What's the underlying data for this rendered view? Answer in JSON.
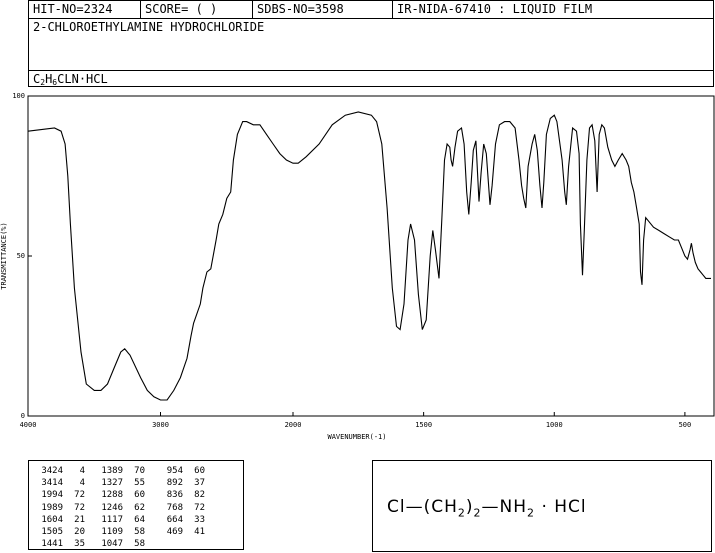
{
  "header": {
    "hit_no": "HIT-NO=2324",
    "score": "SCORE=  (   )",
    "sdbs_no": "SDBS-NO=3598",
    "ir_info": "IR-NIDA-67410 : LIQUID FILM",
    "compound_name": "2-CHLOROETHYLAMINE HYDROCHLORIDE",
    "formula_parts": [
      "C",
      "2",
      "H",
      "6",
      "CLN",
      "·HCL"
    ]
  },
  "structure": {
    "parts": [
      "Cl",
      "—",
      "(",
      "CH",
      "2",
      ")",
      "2",
      "—",
      "NH",
      "2",
      "·",
      "HCl"
    ]
  },
  "peak_table": {
    "rows": [
      [
        3424,
        4,
        1389,
        70,
        954,
        60
      ],
      [
        3414,
        4,
        1327,
        55,
        892,
        37
      ],
      [
        1994,
        72,
        1288,
        60,
        836,
        82
      ],
      [
        1989,
        72,
        1246,
        62,
        768,
        72
      ],
      [
        1604,
        21,
        1117,
        64,
        664,
        33
      ],
      [
        1505,
        20,
        1109,
        58,
        469,
        41
      ],
      [
        1441,
        35,
        1047,
        58,
        null,
        null
      ]
    ]
  },
  "chart_data": {
    "type": "line",
    "xlabel": "WAVENUMBER(-1)",
    "ylabel": "TRANSMITTANCE(%)",
    "xlim": [
      4000,
      400
    ],
    "ylim": [
      0,
      100
    ],
    "xticks": [
      4000,
      3000,
      2000,
      1500,
      1000,
      500
    ],
    "yticks": [
      0,
      50,
      100
    ],
    "grid": false,
    "series": [
      {
        "points": [
          [
            4000,
            89
          ],
          [
            3900,
            89.5
          ],
          [
            3800,
            90
          ],
          [
            3750,
            89
          ],
          [
            3720,
            85
          ],
          [
            3700,
            75
          ],
          [
            3680,
            60
          ],
          [
            3650,
            40
          ],
          [
            3600,
            20
          ],
          [
            3560,
            10
          ],
          [
            3500,
            8
          ],
          [
            3450,
            8
          ],
          [
            3400,
            10
          ],
          [
            3350,
            15
          ],
          [
            3300,
            20
          ],
          [
            3270,
            21
          ],
          [
            3230,
            19
          ],
          [
            3150,
            12
          ],
          [
            3100,
            8
          ],
          [
            3050,
            6
          ],
          [
            3000,
            5
          ],
          [
            2950,
            5
          ],
          [
            2900,
            8
          ],
          [
            2850,
            12
          ],
          [
            2800,
            18
          ],
          [
            2770,
            25
          ],
          [
            2750,
            29
          ],
          [
            2700,
            35
          ],
          [
            2680,
            40
          ],
          [
            2650,
            45
          ],
          [
            2620,
            46
          ],
          [
            2580,
            55
          ],
          [
            2560,
            60
          ],
          [
            2530,
            63
          ],
          [
            2500,
            68
          ],
          [
            2470,
            70
          ],
          [
            2450,
            80
          ],
          [
            2420,
            88
          ],
          [
            2380,
            92
          ],
          [
            2350,
            92
          ],
          [
            2300,
            91
          ],
          [
            2250,
            91
          ],
          [
            2200,
            88
          ],
          [
            2150,
            85
          ],
          [
            2100,
            82
          ],
          [
            2050,
            80
          ],
          [
            2000,
            79
          ],
          [
            1980,
            79
          ],
          [
            1950,
            81
          ],
          [
            1900,
            85
          ],
          [
            1850,
            91
          ],
          [
            1800,
            94
          ],
          [
            1750,
            95
          ],
          [
            1700,
            94
          ],
          [
            1680,
            92
          ],
          [
            1660,
            85
          ],
          [
            1640,
            65
          ],
          [
            1620,
            40
          ],
          [
            1604,
            28
          ],
          [
            1590,
            27
          ],
          [
            1575,
            35
          ],
          [
            1560,
            55
          ],
          [
            1550,
            60
          ],
          [
            1535,
            55
          ],
          [
            1520,
            38
          ],
          [
            1505,
            27
          ],
          [
            1490,
            30
          ],
          [
            1475,
            50
          ],
          [
            1465,
            58
          ],
          [
            1455,
            52
          ],
          [
            1441,
            43
          ],
          [
            1430,
            62
          ],
          [
            1420,
            80
          ],
          [
            1410,
            85
          ],
          [
            1400,
            84
          ],
          [
            1395,
            80
          ],
          [
            1389,
            78
          ],
          [
            1380,
            84
          ],
          [
            1370,
            89
          ],
          [
            1355,
            90
          ],
          [
            1345,
            85
          ],
          [
            1335,
            70
          ],
          [
            1327,
            63
          ],
          [
            1318,
            73
          ],
          [
            1310,
            83
          ],
          [
            1300,
            86
          ],
          [
            1288,
            67
          ],
          [
            1280,
            76
          ],
          [
            1270,
            85
          ],
          [
            1260,
            82
          ],
          [
            1246,
            66
          ],
          [
            1238,
            72
          ],
          [
            1225,
            85
          ],
          [
            1210,
            91
          ],
          [
            1190,
            92
          ],
          [
            1170,
            92
          ],
          [
            1150,
            90
          ],
          [
            1135,
            80
          ],
          [
            1125,
            72
          ],
          [
            1117,
            68
          ],
          [
            1109,
            65
          ],
          [
            1100,
            78
          ],
          [
            1085,
            85
          ],
          [
            1075,
            88
          ],
          [
            1065,
            83
          ],
          [
            1055,
            72
          ],
          [
            1047,
            65
          ],
          [
            1040,
            73
          ],
          [
            1030,
            88
          ],
          [
            1015,
            93
          ],
          [
            1000,
            94
          ],
          [
            990,
            92
          ],
          [
            980,
            86
          ],
          [
            970,
            80
          ],
          [
            960,
            70
          ],
          [
            954,
            66
          ],
          [
            945,
            78
          ],
          [
            930,
            90
          ],
          [
            915,
            89
          ],
          [
            905,
            82
          ],
          [
            900,
            60
          ],
          [
            892,
            44
          ],
          [
            885,
            58
          ],
          [
            875,
            80
          ],
          [
            865,
            90
          ],
          [
            855,
            91
          ],
          [
            845,
            86
          ],
          [
            836,
            70
          ],
          [
            828,
            88
          ],
          [
            818,
            91
          ],
          [
            808,
            90
          ],
          [
            795,
            84
          ],
          [
            780,
            80
          ],
          [
            768,
            78
          ],
          [
            755,
            80
          ],
          [
            740,
            82
          ],
          [
            725,
            80
          ],
          [
            715,
            78
          ],
          [
            705,
            73
          ],
          [
            695,
            70
          ],
          [
            685,
            65
          ],
          [
            675,
            60
          ],
          [
            670,
            45
          ],
          [
            664,
            41
          ],
          [
            658,
            55
          ],
          [
            650,
            62
          ],
          [
            640,
            61
          ],
          [
            620,
            59
          ],
          [
            600,
            58
          ],
          [
            580,
            57
          ],
          [
            560,
            56
          ],
          [
            540,
            55
          ],
          [
            525,
            55
          ],
          [
            510,
            52
          ],
          [
            500,
            50
          ],
          [
            490,
            49
          ],
          [
            480,
            52
          ],
          [
            475,
            54
          ],
          [
            469,
            51
          ],
          [
            460,
            48
          ],
          [
            450,
            46
          ],
          [
            440,
            45
          ],
          [
            430,
            44
          ],
          [
            420,
            43
          ],
          [
            400,
            43
          ]
        ]
      }
    ]
  }
}
